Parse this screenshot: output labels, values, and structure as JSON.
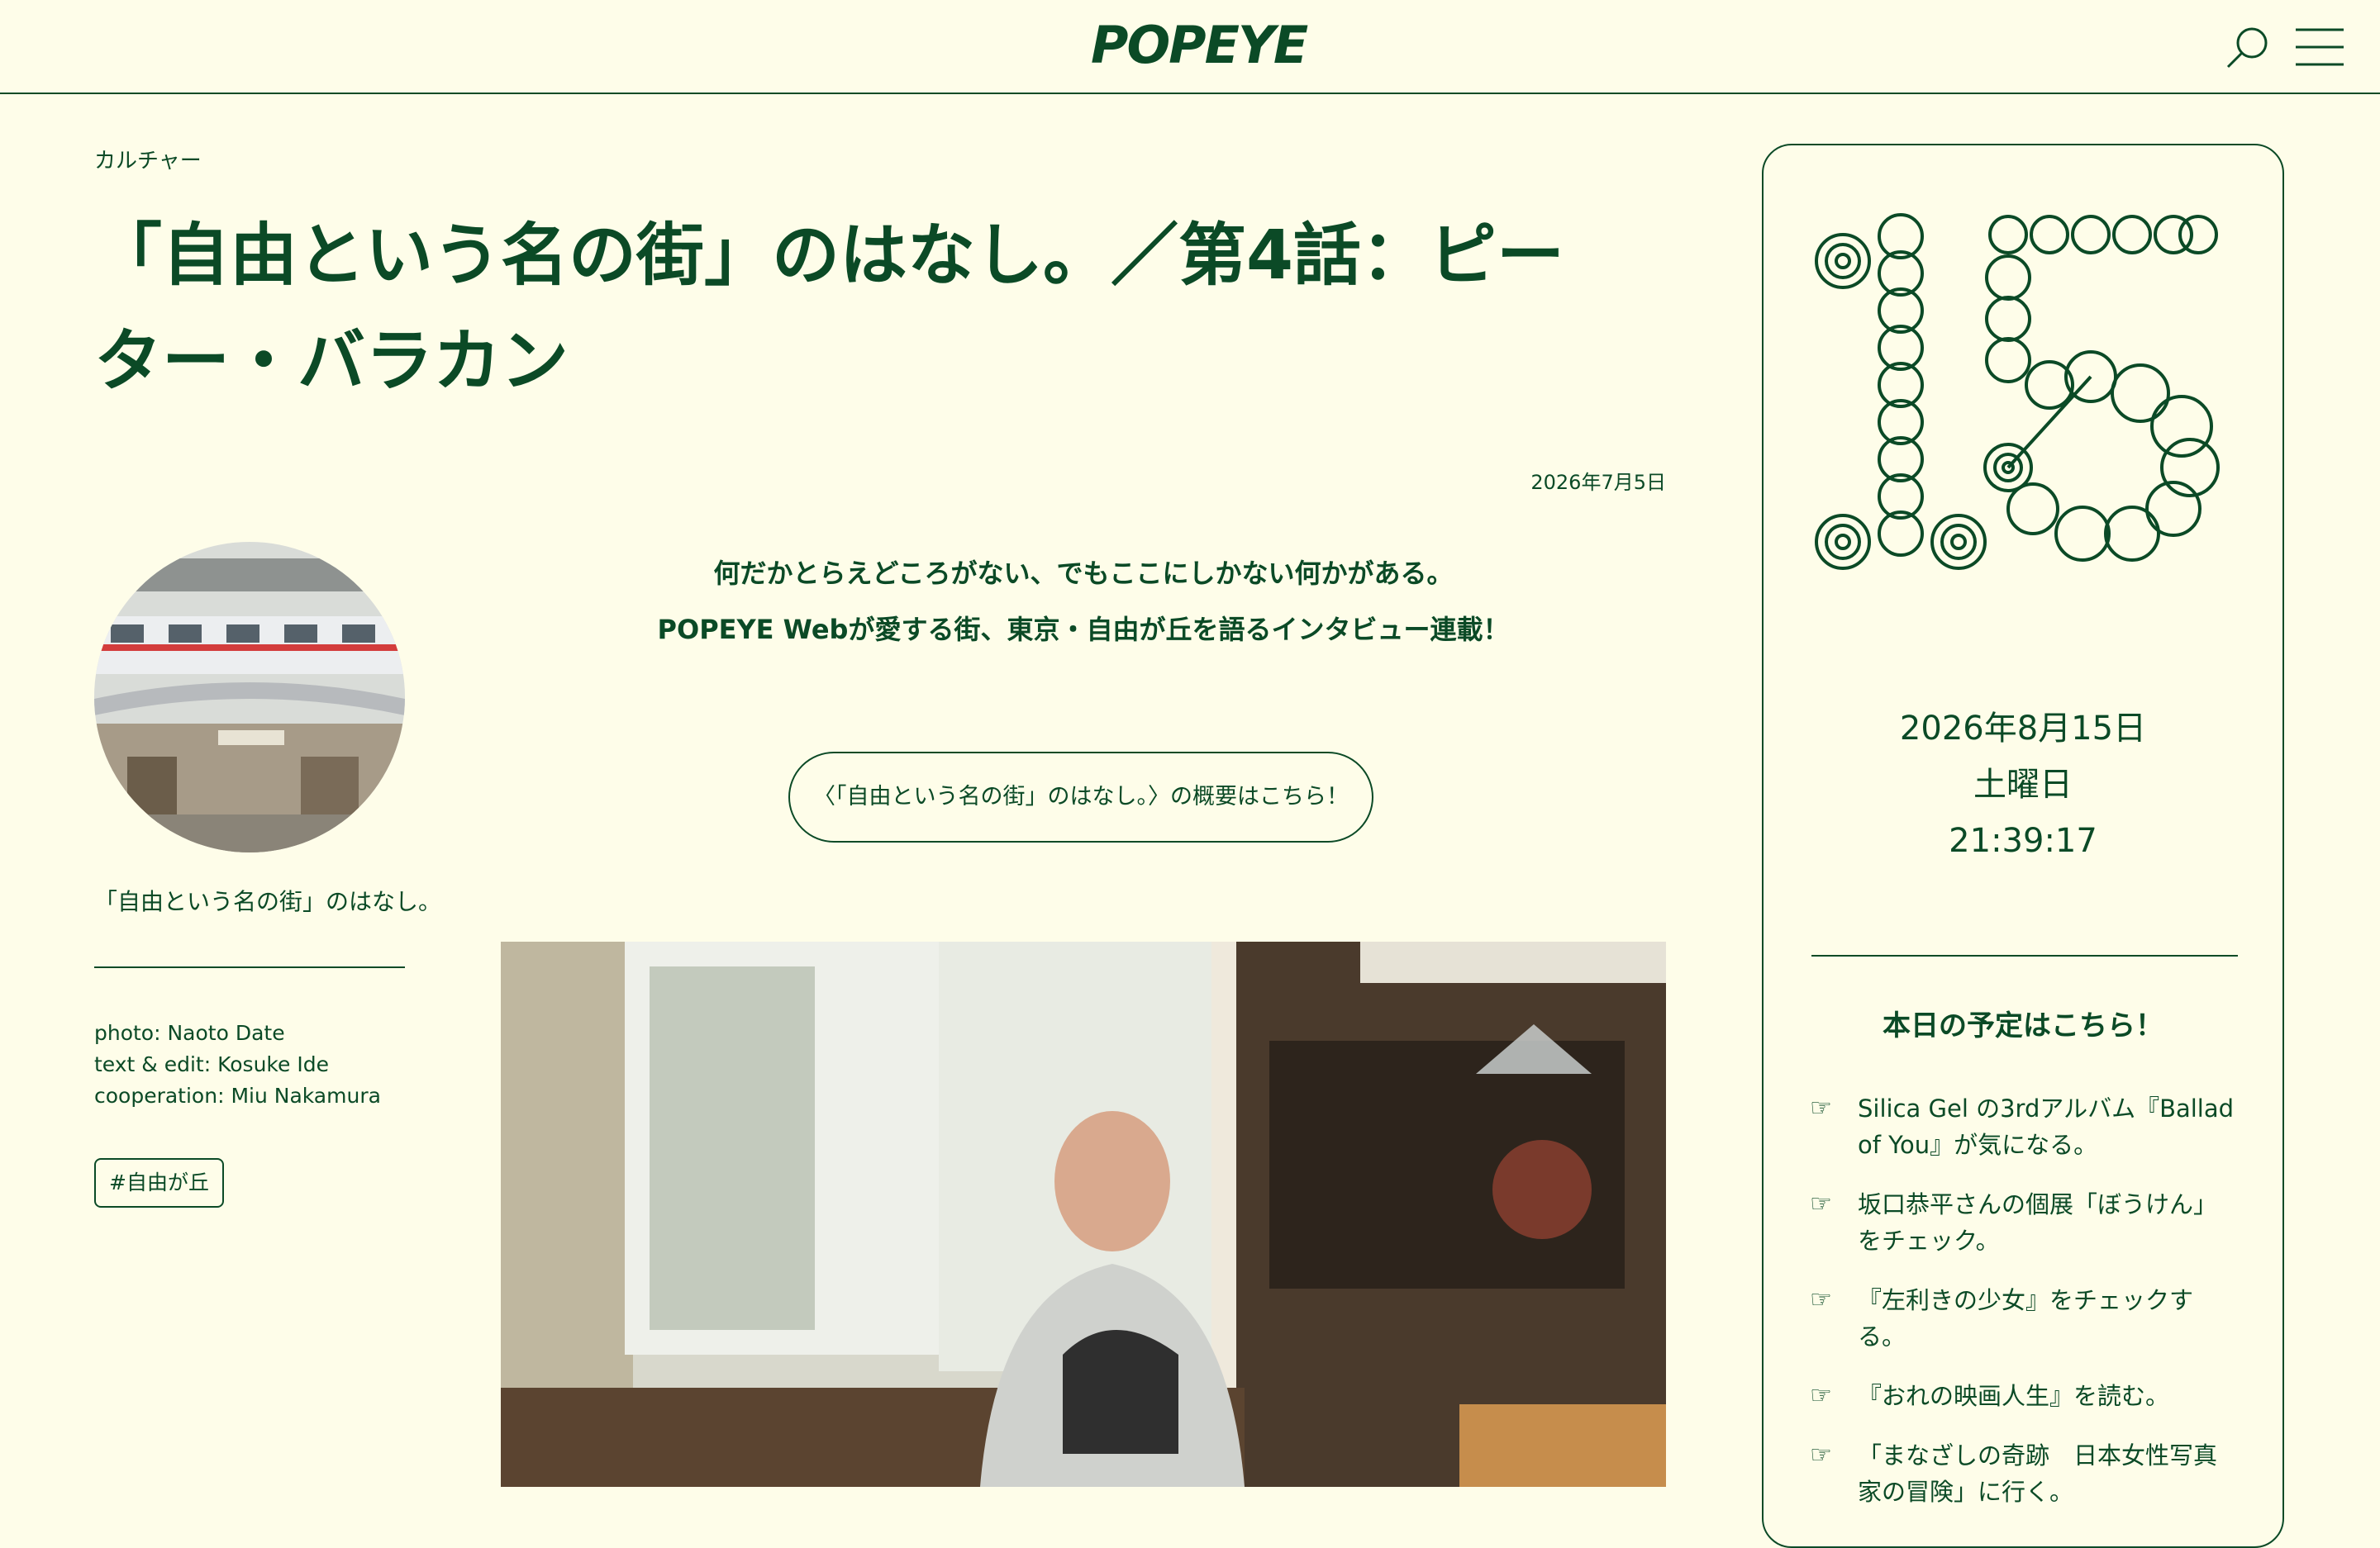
{
  "header": {
    "logo": "POPEYE",
    "search_icon": "search-icon",
    "menu_icon": "hamburger-menu-icon"
  },
  "article": {
    "category": "カルチャー",
    "title": "「自由という名の街」のはなし。／第4話：ピーター・バラカン",
    "date": "2026年7月5日",
    "lead_line1": "何だかとらえどころがない、でもここにしかない何かがある。",
    "lead_line2": "POPEYE Webが愛する街、東京・自由が丘を語るインタビュー連載！",
    "overview_button": "〈「自由という名の街」のはなし。〉の概要はこちら！"
  },
  "series": {
    "link_label": "「自由という名の街」のはなし。",
    "credits": [
      "photo: Naoto Date",
      "text & edit: Kosuke Ide",
      "cooperation: Miu Nakamura"
    ],
    "tag": "#自由が丘"
  },
  "sidebar": {
    "date": "2026年8月15日",
    "weekday": "土曜日",
    "time": "21:39:17",
    "plans_heading": "本日の予定はこちら！",
    "plans": [
      "Silica Gel の3rdアルバム『Ballad of You』が気になる。",
      "坂口恭平さんの個展「ぼうけん」をチェック。",
      "『左利きの少女』をチェックする。",
      "『おれの映画人生』を読む。",
      "「まなざしの奇跡　日本女性写真家の冒険」に行く。"
    ],
    "plan_icon": "pointing-hand-icon"
  },
  "colors": {
    "background": "#fefde9",
    "accent": "#0b4a26"
  }
}
